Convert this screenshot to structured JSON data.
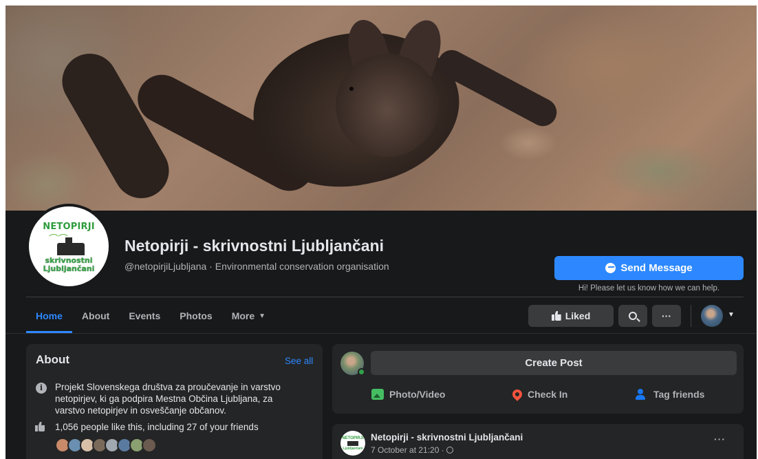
{
  "page": {
    "name": "Netopirji - skrivnostni Ljubljančani",
    "handle_line": "@netopirjiLjubljana · Environmental conservation organisation",
    "logo": {
      "top": "NETOPIRJI",
      "bottom_line1": "skrivnostni",
      "bottom_line2": "Ljubljančani"
    }
  },
  "actions": {
    "send_message": "Send Message",
    "send_hint": "Hi! Please let us know how we can help.",
    "liked": "Liked",
    "more_dots": "···"
  },
  "nav": {
    "tabs": [
      {
        "label": "Home",
        "active": true
      },
      {
        "label": "About"
      },
      {
        "label": "Events"
      },
      {
        "label": "Photos"
      },
      {
        "label": "More"
      }
    ],
    "caret": "▼"
  },
  "about": {
    "title": "About",
    "see_all": "See all",
    "description": "Projekt Slovenskega društva za proučevanje in varstvo netopirjev, ki ga podpira Mestna Občina Ljubljana, za varstvo netopirjev in osveščanje občanov.",
    "likes": "1,056 people like this, including 27 of your friends",
    "friend_colors": [
      "#c98a6a",
      "#6a8fb0",
      "#d8c0a8",
      "#7a6a5a",
      "#a0a8b0",
      "#5a7aa0",
      "#8aa070",
      "#6b5a50"
    ]
  },
  "composer": {
    "create_post": "Create Post",
    "photo_video": "Photo/Video",
    "check_in": "Check In",
    "tag_friends": "Tag friends"
  },
  "post": {
    "author": "Netopirji - skrivnostni Ljubljančani",
    "timestamp": "7 October at 21:20 ·",
    "more": "···"
  },
  "colors": {
    "accent": "#2d88ff",
    "background": "#18191a",
    "card": "#242526"
  }
}
